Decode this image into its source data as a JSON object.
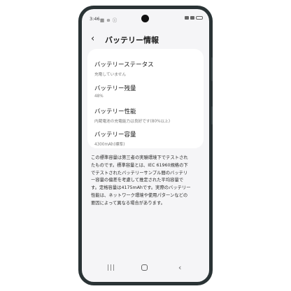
{
  "status_bar": {
    "time": "3:46",
    "notification_icons": "▦ ⊛ ⓘ"
  },
  "header": {
    "back_glyph": "‹",
    "title": "バッテリー情報"
  },
  "items": [
    {
      "title": "バッテリーステータス",
      "value": "充電していません"
    },
    {
      "title": "バッテリー残量",
      "value": "48%"
    },
    {
      "title": "バッテリー性能",
      "value": "内蔵電池の充電能力は良好です(80%以上)"
    },
    {
      "title": "バッテリー容量",
      "value": "4300mAh(標準)"
    }
  ],
  "description_lines": [
    "この標準容量は第三者の実験環境下でテストされ",
    "たものです。標準容量とは、IEC 61960規格の下",
    "でテストされたバッテリーサンプル間のバッテリ",
    "ー容量の偏差を考慮して推定された平均容量で",
    "す。定格容量は4175mAhです。実際のバッテリー",
    "性能は、ネットワーク環境や使用パターンなどの",
    "要因によって異なる場合があります。"
  ],
  "nav": {
    "recent": "|||",
    "back": "‹"
  }
}
